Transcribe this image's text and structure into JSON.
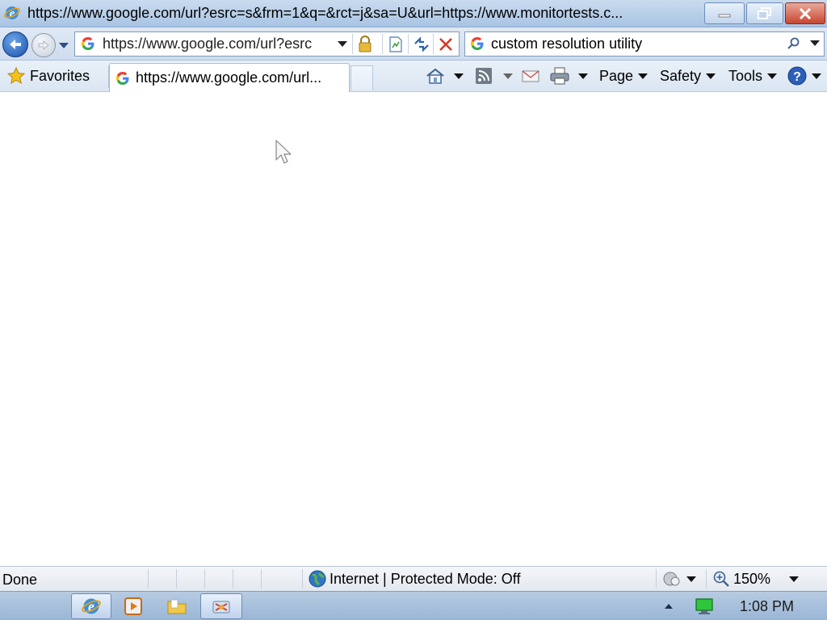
{
  "window": {
    "title": "https://www.google.com/url?esrc=s&frm=1&q=&rct=j&sa=U&url=https://www.monitortests.c..."
  },
  "address_bar": {
    "url": "https://www.google.com/url?esrc"
  },
  "search": {
    "query": "custom resolution utility"
  },
  "favorites": {
    "label": "Favorites"
  },
  "tabs": [
    {
      "label": "https://www.google.com/url...",
      "active": true
    }
  ],
  "command_bar": {
    "page_label": "Page",
    "safety_label": "Safety",
    "tools_label": "Tools"
  },
  "status_bar": {
    "status": "Done",
    "zone": "Internet | Protected Mode: Off",
    "zoom": "150%"
  },
  "taskbar": {
    "clock": "1:08 PM"
  },
  "colors": {
    "accent": "#1c4fa6",
    "close_button": "#c8462f"
  }
}
